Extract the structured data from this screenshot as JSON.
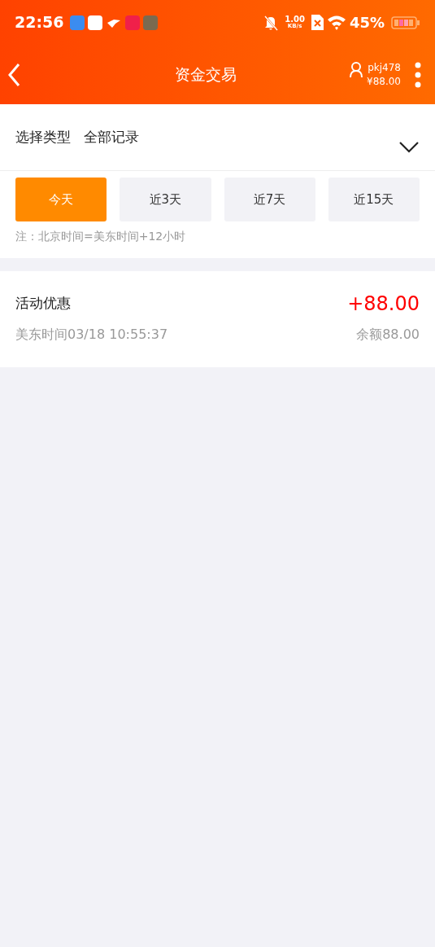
{
  "status_bar": {
    "time": "22:56",
    "speed_value": "1.00",
    "speed_unit": "KB/s",
    "battery_percent": "45%"
  },
  "header": {
    "title": "资金交易",
    "username": "pkj478",
    "balance": "¥88.00"
  },
  "filter": {
    "label": "选择类型",
    "value": "全部记录"
  },
  "periods": [
    {
      "label": "今天",
      "selected": true
    },
    {
      "label": "近3天",
      "selected": false
    },
    {
      "label": "近7天",
      "selected": false
    },
    {
      "label": "近15天",
      "selected": false
    }
  ],
  "note": "注：北京时间=美东时间+12小时",
  "records": [
    {
      "title": "活动优惠",
      "amount": "+88.00",
      "time": "美东时间03/18 10:55:37",
      "balance": "余额88.00"
    }
  ]
}
